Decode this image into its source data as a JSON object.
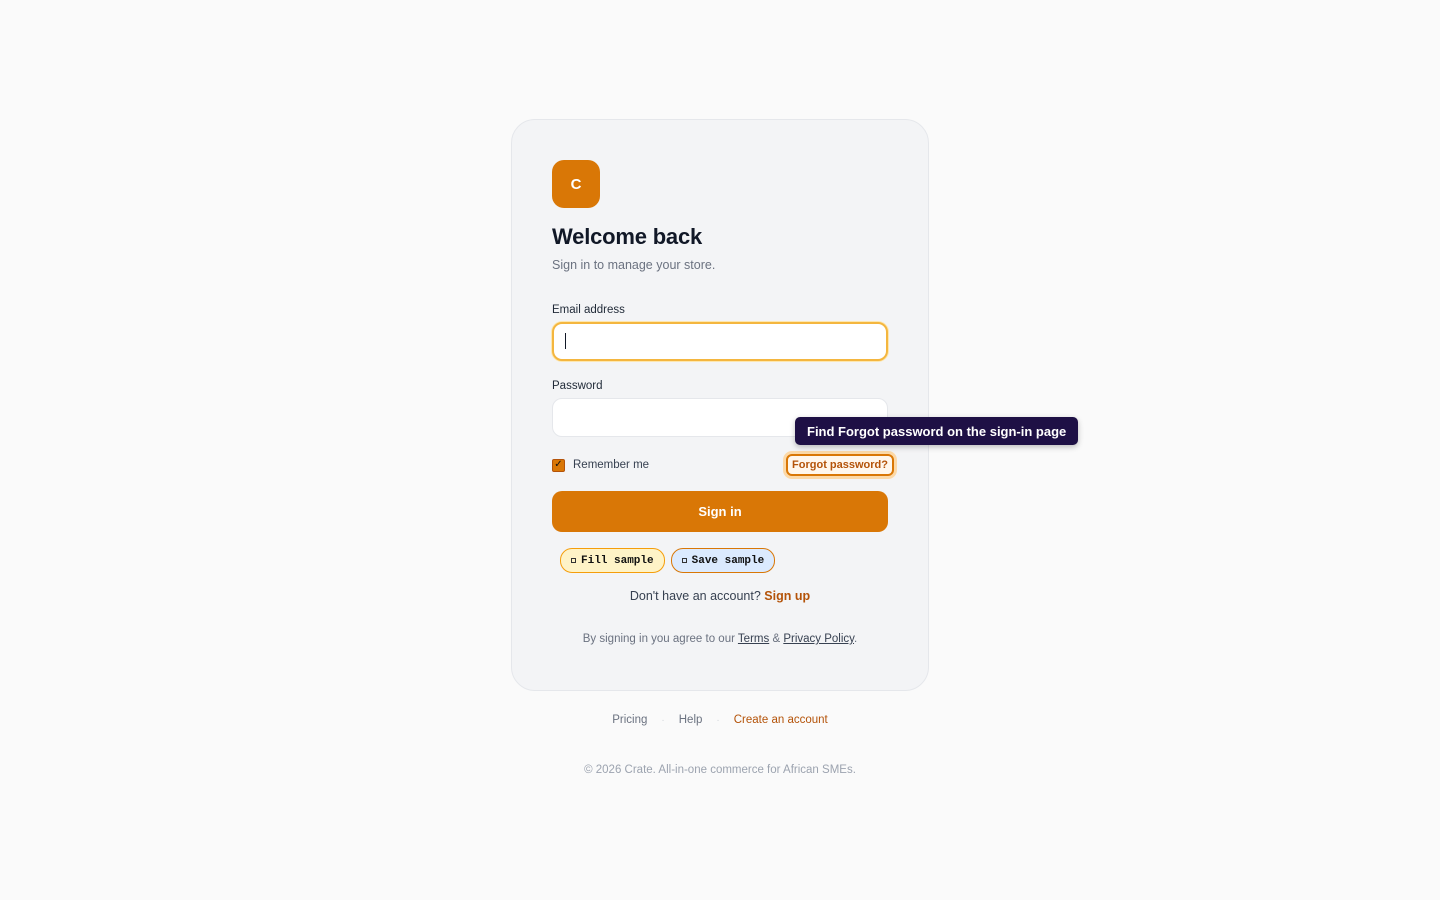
{
  "brand": {
    "logo_letter": "C",
    "accent": "#d97706"
  },
  "header": {
    "title": "Welcome back",
    "subtitle": "Sign in to manage your store."
  },
  "form": {
    "email_label": "Email address",
    "email_value": "",
    "password_label": "Password",
    "password_value": "",
    "remember_label": "Remember me",
    "remember_checked": true,
    "forgot_label": "Forgot password?",
    "signin_label": "Sign in"
  },
  "samples": {
    "fill_label": "Fill sample",
    "save_label": "Save sample"
  },
  "signup": {
    "prompt": "Don't have an account?",
    "link": "Sign up"
  },
  "terms": {
    "prefix": "By signing in you agree to our",
    "terms_link": "Terms",
    "amp": "&",
    "privacy_link": "Privacy Policy",
    "suffix": "."
  },
  "footer": {
    "links": [
      "Pricing",
      "Help",
      "Create an account"
    ],
    "separator": "·",
    "copyright": "© 2026 Crate. All-in-one commerce for African SMEs."
  },
  "tooltip": {
    "text": "Find Forgot password on the sign-in page"
  }
}
